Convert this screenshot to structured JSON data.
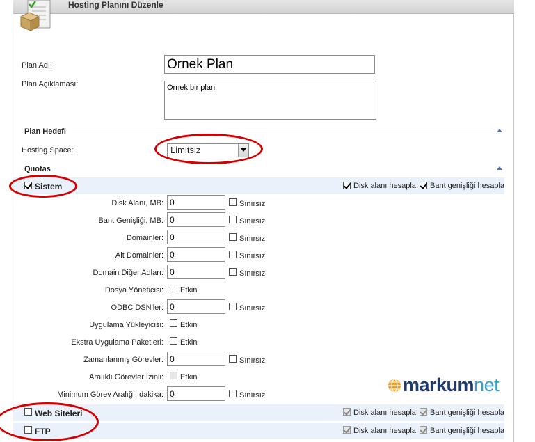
{
  "header": {
    "title": "Hosting Planını Düzenle"
  },
  "form": {
    "plan_name_label": "Plan Adı:",
    "plan_name_value": "Ornek Plan",
    "plan_desc_label": "Plan Açıklaması:",
    "plan_desc_value": "Ornek bir plan"
  },
  "plan_target": {
    "section_title": "Plan Hedefi",
    "hosting_space_label": "Hosting Space:",
    "hosting_space_value": "Limitsiz"
  },
  "quotas": {
    "section_title": "Quotas",
    "disk_label": "Disk alanı hesapla",
    "bw_label": "Bant genişliği hesapla",
    "groups": [
      {
        "name": "Sistem",
        "checked": true
      },
      {
        "name": "Web Siteleri",
        "checked": false
      },
      {
        "name": "FTP",
        "checked": false
      }
    ],
    "rows": [
      {
        "label": "Disk Alanı, MB:",
        "type": "number",
        "value": "0",
        "aux": "Sınırsız"
      },
      {
        "label": "Bant Genişliği, MB:",
        "type": "number",
        "value": "0",
        "aux": "Sınırsız"
      },
      {
        "label": "Domainler:",
        "type": "number",
        "value": "0",
        "aux": "Sınırsız"
      },
      {
        "label": "Alt Domainler:",
        "type": "number",
        "value": "0",
        "aux": "Sınırsız"
      },
      {
        "label": "Domain Diğer Adları:",
        "type": "number",
        "value": "0",
        "aux": "Sınırsız"
      },
      {
        "label": "Dosya Yöneticisi:",
        "type": "bool",
        "aux": "Etkin"
      },
      {
        "label": "ODBC DSN'ler:",
        "type": "number",
        "value": "0",
        "aux": "Sınırsız"
      },
      {
        "label": "Uygulama Yükleyicisi:",
        "type": "bool",
        "aux": "Etkin"
      },
      {
        "label": "Ekstra Uygulama Paketleri:",
        "type": "bool",
        "aux": "Etkin"
      },
      {
        "label": "Zamanlanmış Görevler:",
        "type": "number",
        "value": "0",
        "aux": "Sınırsız"
      },
      {
        "label": "Aralıklı Görevler İzinli:",
        "type": "bool-disabled",
        "aux": "Etkin"
      },
      {
        "label": "Minimum Görev Aralığı, dakika:",
        "type": "number",
        "value": "0",
        "aux": "Sınırsız"
      }
    ]
  },
  "brand": {
    "name_main": "markum",
    "name_suffix": "net"
  },
  "colors": {
    "annotation": "#d40000",
    "group_bg": "#eaf1fb",
    "brand_dark": "#1f3b6d",
    "brand_light": "#3aa0c6",
    "brand_orange": "#f0a020"
  }
}
